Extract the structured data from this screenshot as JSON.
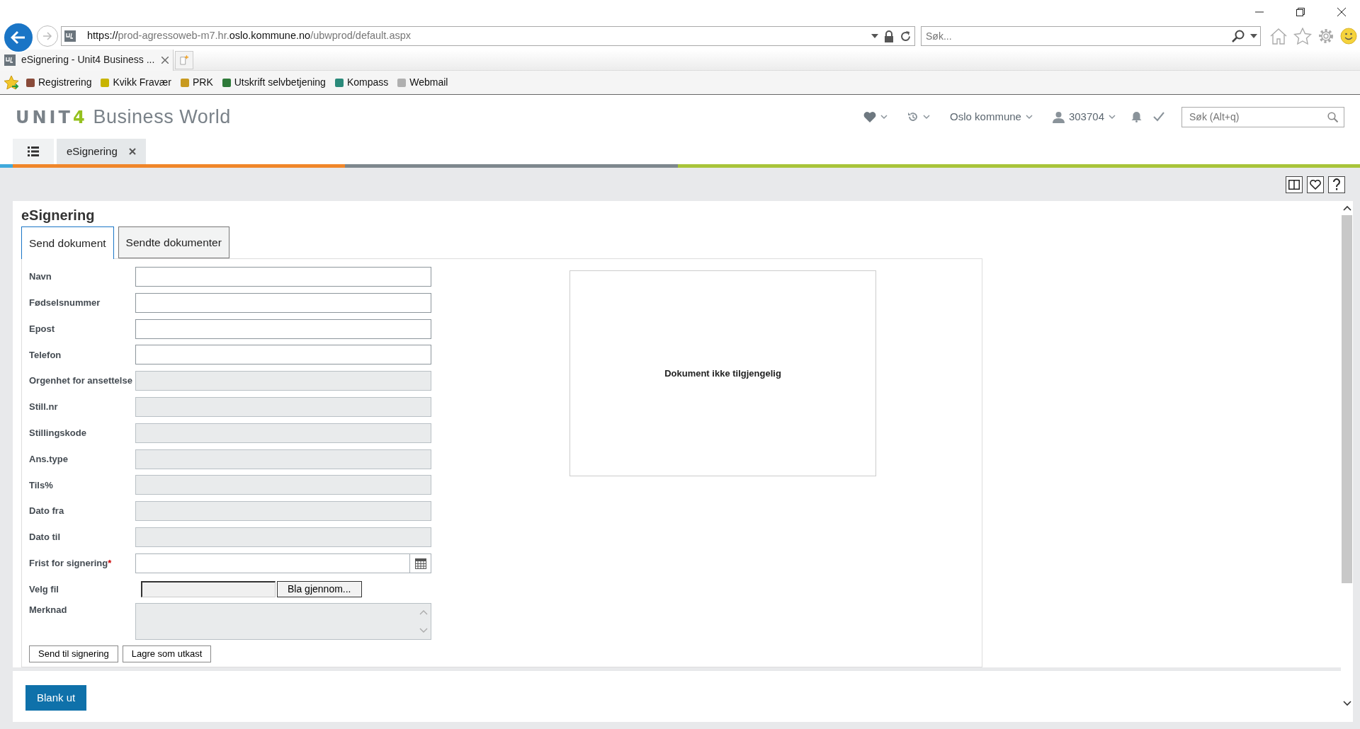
{
  "browser": {
    "url": [
      {
        "text": "https://",
        "strong": true
      },
      {
        "text": "prod-agressoweb-m7.hr.",
        "strong": false
      },
      {
        "text": "oslo.kommune.no",
        "strong": true
      },
      {
        "text": "/ubwprod/default.aspx",
        "strong": false
      }
    ],
    "search_placeholder": "Søk...",
    "tabs": [
      {
        "title": "eSignering - Unit4 Business ...",
        "selected": true
      }
    ],
    "favorites": [
      {
        "label": "Registrering",
        "color": "#8a4b3a"
      },
      {
        "label": "Kvikk Fravær",
        "color": "#c8b400"
      },
      {
        "label": "PRK",
        "color": "#c89a20"
      },
      {
        "label": "Utskrift selvbetjening",
        "color": "#2f7a3a"
      },
      {
        "label": "Kompass",
        "color": "#2a8a7a"
      },
      {
        "label": "Webmail",
        "color": "#b0b0b0"
      }
    ]
  },
  "app": {
    "logo": {
      "brand": "UNIT",
      "accent": "4",
      "product": "Business World"
    },
    "company": "Oslo kommune",
    "user": "303704",
    "search_placeholder": "Søk (Alt+q)",
    "tabs": [
      {
        "label": "eSignering",
        "selected": true
      }
    ]
  },
  "page": {
    "title": "eSignering",
    "tabs": [
      {
        "label": "Send dokument",
        "selected": true
      },
      {
        "label": "Sendte dokumenter",
        "selected": false
      }
    ],
    "fields": [
      {
        "kind": "text",
        "label": "Navn",
        "disabled": false,
        "required": false
      },
      {
        "kind": "text",
        "label": "Fødselsnummer",
        "disabled": false,
        "required": false
      },
      {
        "kind": "text",
        "label": "Epost",
        "disabled": false,
        "required": false
      },
      {
        "kind": "text",
        "label": "Telefon",
        "disabled": false,
        "required": false
      },
      {
        "kind": "text",
        "label": "Orgenhet for ansettelse",
        "disabled": true,
        "required": false
      },
      {
        "kind": "text",
        "label": "Still.nr",
        "disabled": true,
        "required": false
      },
      {
        "kind": "text",
        "label": "Stillingskode",
        "disabled": true,
        "required": false
      },
      {
        "kind": "text",
        "label": "Ans.type",
        "disabled": true,
        "required": false
      },
      {
        "kind": "text",
        "label": "Tils%",
        "disabled": true,
        "required": false
      },
      {
        "kind": "text",
        "label": "Dato fra",
        "disabled": true,
        "required": false
      },
      {
        "kind": "text",
        "label": "Dato til",
        "disabled": true,
        "required": false
      },
      {
        "kind": "date",
        "label": "Frist for signering",
        "disabled": false,
        "required": true
      },
      {
        "kind": "file",
        "label": "Velg fil",
        "button": "Bla gjennom..."
      },
      {
        "kind": "textarea",
        "label": "Merknad",
        "disabled": true,
        "required": false
      }
    ],
    "required_mark": "*",
    "preview_text": "Dokument ikke tilgjengelig",
    "actions": [
      "Send til signering",
      "Lagre som utkast"
    ]
  },
  "footer": {
    "button": "Blank ut"
  }
}
